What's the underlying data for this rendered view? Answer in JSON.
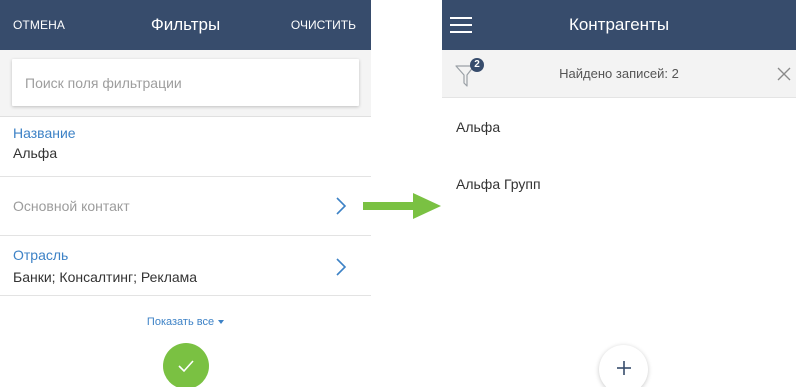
{
  "filters_screen": {
    "header": {
      "cancel_label": "ОТМЕНА",
      "title": "Фильтры",
      "clear_label": "ОЧИСТИТЬ"
    },
    "search": {
      "placeholder": "Поиск поля фильтрации",
      "value": ""
    },
    "fields": [
      {
        "label": "Название",
        "value": "Альфа",
        "chevron": false
      },
      {
        "label": "Основной контакт",
        "value": "",
        "chevron": true
      },
      {
        "label": "Отрасль",
        "value": "Банки; Консалтинг; Реклама",
        "chevron": true
      }
    ],
    "show_all_label": "Показать все",
    "apply_icon": "check-icon"
  },
  "arrow": {
    "icon": "right-arrow-icon",
    "color": "#7ac142"
  },
  "contractors_screen": {
    "header": {
      "menu_icon": "hamburger-icon",
      "title": "Контрагенты"
    },
    "filter_bar": {
      "filter_icon": "funnel-icon",
      "badge_count": "2",
      "found_text": "Найдено записей: 2",
      "close_icon": "close-icon"
    },
    "records": [
      "Альфа",
      "Альфа Групп"
    ],
    "add_icon": "plus-icon"
  },
  "colors": {
    "header_bg": "#374c6c",
    "link_blue": "#3d82c6",
    "accent_green": "#7ac142"
  }
}
